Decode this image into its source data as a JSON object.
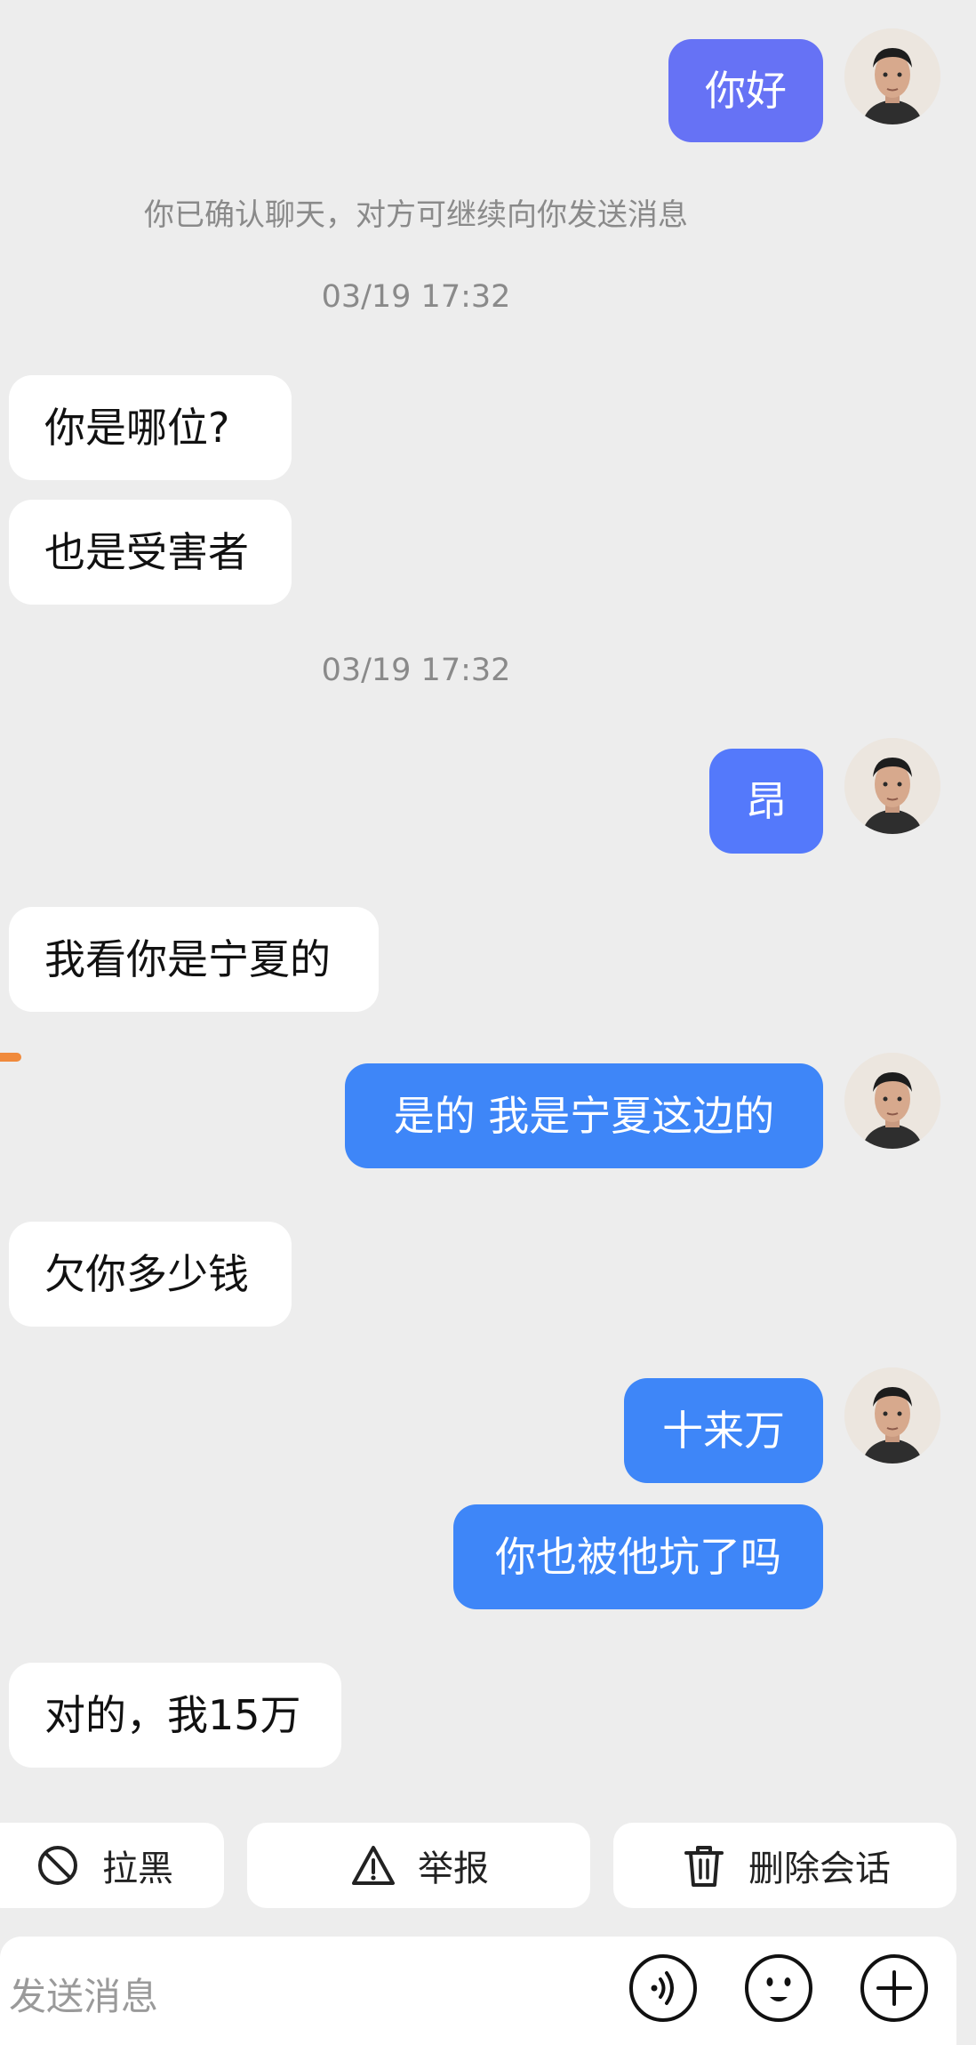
{
  "colors": {
    "background": "#ededed",
    "incoming_bubble": "#ffffff",
    "outgoing_bubble_first": "#6672f5",
    "outgoing_bubble_second": "#5479fb",
    "outgoing_bubble": "#3e86f8",
    "accent_marker": "#f08a3c"
  },
  "chat": {
    "system_notice": "你已确认聊天，对方可继续向你发送消息",
    "timestamps": [
      "03/19 17:32",
      "03/19 17:32"
    ],
    "messages": [
      {
        "side": "out",
        "text": "你好",
        "avatar": "avatar"
      },
      {
        "side": "in",
        "text": "你是哪位?"
      },
      {
        "side": "in",
        "text": "也是受害者"
      },
      {
        "side": "out",
        "text": "昂",
        "avatar": "avatar"
      },
      {
        "side": "in",
        "text": "我看你是宁夏的"
      },
      {
        "side": "out",
        "text": "是的 我是宁夏这边的",
        "avatar": "avatar"
      },
      {
        "side": "in",
        "text": "欠你多少钱"
      },
      {
        "side": "out",
        "text": "十来万",
        "avatar": "avatar"
      },
      {
        "side": "out",
        "text": "你也被他坑了吗"
      },
      {
        "side": "in",
        "text": "对的，我15万"
      }
    ]
  },
  "actions": {
    "block": {
      "label": "拉黑",
      "icon": "block-icon"
    },
    "report": {
      "label": "举报",
      "icon": "warning-icon"
    },
    "delete": {
      "label": "删除会话",
      "icon": "trash-icon"
    }
  },
  "composer": {
    "placeholder": "发送消息",
    "voice_icon": "voice-icon",
    "emoji_icon": "emoji-icon",
    "add_icon": "plus-icon"
  }
}
